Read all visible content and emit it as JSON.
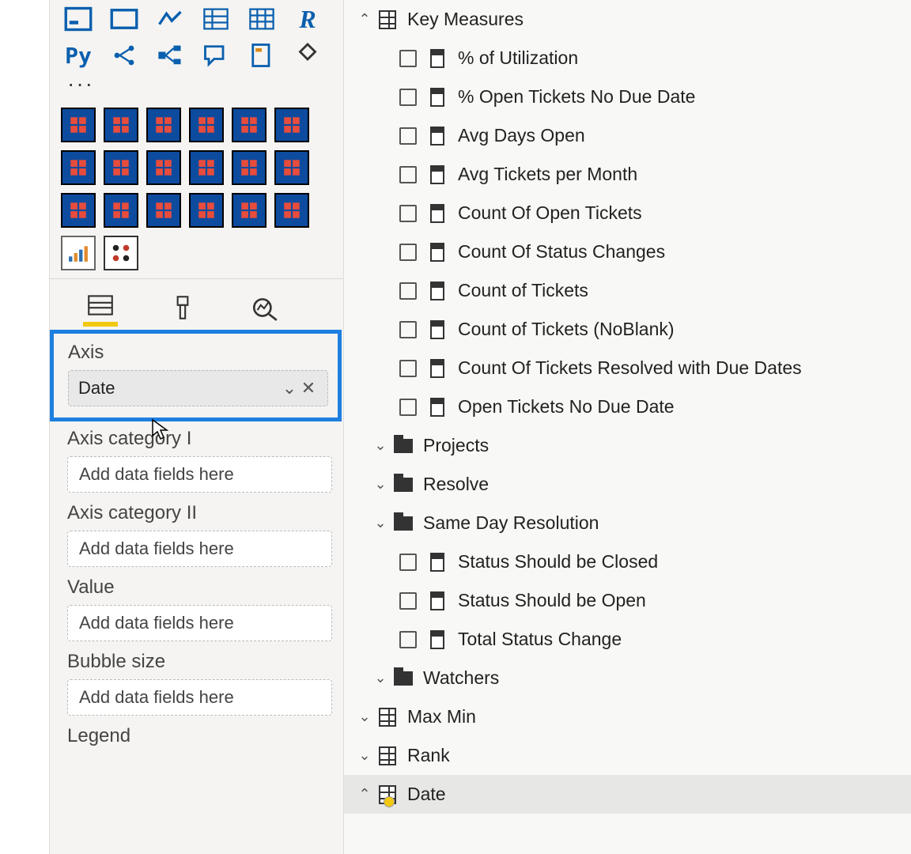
{
  "viz_palette": {
    "py_label": "Py",
    "ellipsis": "···"
  },
  "field_wells": {
    "axis": {
      "label": "Axis",
      "pill": "Date"
    },
    "axis_cat1": {
      "label": "Axis category I",
      "placeholder": "Add data fields here"
    },
    "axis_cat2": {
      "label": "Axis category II",
      "placeholder": "Add data fields here"
    },
    "value": {
      "label": "Value",
      "placeholder": "Add data fields here"
    },
    "bubble": {
      "label": "Bubble size",
      "placeholder": "Add data fields here"
    },
    "legend": {
      "label": "Legend"
    }
  },
  "fields_tree": {
    "key_measures": {
      "label": "Key Measures",
      "items": [
        "% of Utilization",
        "% Open Tickets No Due Date",
        "Avg Days Open",
        "Avg Tickets per Month",
        "Count Of Open Tickets",
        "Count Of Status Changes",
        "Count of Tickets",
        "Count of Tickets (NoBlank)",
        "Count Of Tickets Resolved with Due Dates",
        "Open Tickets No Due Date"
      ]
    },
    "folders": {
      "projects": "Projects",
      "resolve": "Resolve",
      "same_day": "Same Day Resolution",
      "watchers": "Watchers"
    },
    "status_measures": [
      "Status Should be Closed",
      "Status Should be Open",
      "Total Status Change"
    ],
    "tables": {
      "maxmin": "Max Min",
      "rank": "Rank",
      "date": "Date"
    }
  }
}
